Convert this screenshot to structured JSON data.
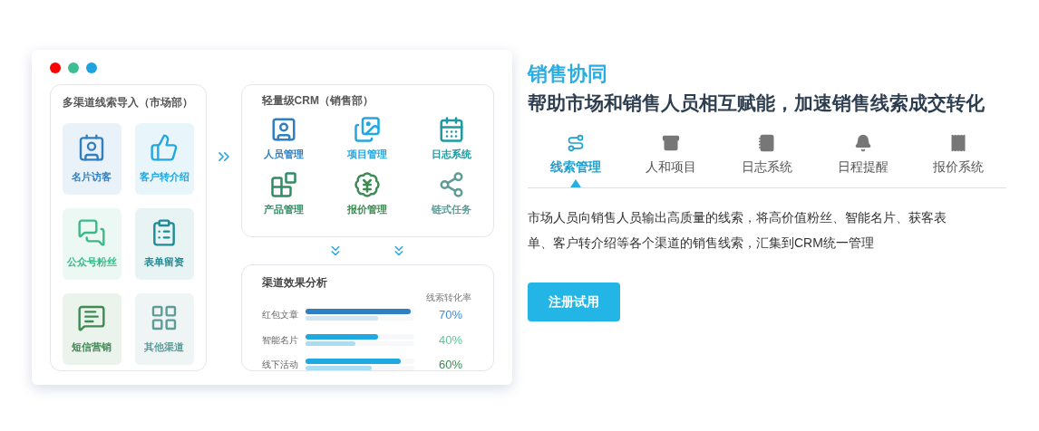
{
  "mockup": {
    "channels_panel": {
      "title": "多渠道线索导入（市场部）",
      "tiles": [
        {
          "label": "名片访客",
          "color": "#2f7fc1"
        },
        {
          "label": "客户转介绍",
          "color": "#22a7e0"
        },
        {
          "label": "公众号粉丝",
          "color": "#3cb98a"
        },
        {
          "label": "表单留资",
          "color": "#1e8c96"
        },
        {
          "label": "短信营销",
          "color": "#3d8a52"
        },
        {
          "label": "其他渠道",
          "color": "#5f9c98"
        }
      ]
    },
    "crm_panel": {
      "title": "轻量级CRM（销售部）",
      "modules": [
        {
          "label": "人员管理",
          "color": "#2f7fc1"
        },
        {
          "label": "项目管理",
          "color": "#22a7e0"
        },
        {
          "label": "日志系统",
          "color": "#1e9aa0"
        },
        {
          "label": "产品管理",
          "color": "#2f8c63"
        },
        {
          "label": "报价管理",
          "color": "#3d8a52"
        },
        {
          "label": "链式任务",
          "color": "#5f9c98"
        }
      ]
    },
    "analysis_panel": {
      "title": "渠道效果分析",
      "column_header": "线索转化率",
      "rows": [
        {
          "label": "红包文章",
          "value": "70%",
          "color": "#3a8fd6",
          "bars": [
            {
              "level": 0.97
            },
            {
              "level": 0.67
            }
          ]
        },
        {
          "label": "智能名片",
          "value": "40%",
          "color": "#5cc99a",
          "bars": [
            {
              "level": 0.67
            },
            {
              "level": 0.46
            }
          ]
        },
        {
          "label": "线下活动",
          "value": "60%",
          "color": "#3d8a52",
          "bars": [
            {
              "level": 0.88
            },
            {
              "level": 0.61
            }
          ]
        }
      ]
    }
  },
  "section": {
    "title": "销售协同",
    "subtitle": "帮助市场和销售人员相互赋能，加速销售线索成交转化",
    "tabs": [
      {
        "label": "线索管理",
        "selected": true
      },
      {
        "label": "人和项目",
        "selected": false
      },
      {
        "label": "日志系统",
        "selected": false
      },
      {
        "label": "日程提醒",
        "selected": false
      },
      {
        "label": "报价系统",
        "selected": false
      }
    ],
    "description": "市场人员向销售人员输出高质量的线索，将高价值粉丝、智能名片、获客表单、客户转介绍等各个渠道的销售线索，汇集到CRM统一管理",
    "button": "注册试用"
  }
}
